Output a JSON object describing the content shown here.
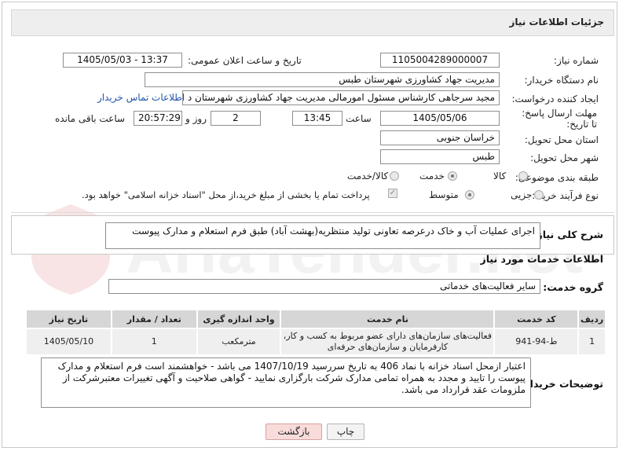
{
  "header": {
    "title": "جزئیات اطلاعات نیاز"
  },
  "form": {
    "need_number_label": "شماره نیاز:",
    "need_number": "1105004289000007",
    "announce_label": "تاریخ و ساعت اعلان عمومی:",
    "announce_value": "1405/05/03 - 13:37",
    "buyer_org_label": "نام دستگاه خریدار:",
    "buyer_org": "مدیریت جهاد کشاورزی شهرستان طبس",
    "creator_label": "ایجاد کننده درخواست:",
    "creator": "مجید سرجاهی کارشناس مسئول امورمالی مدیریت جهاد کشاورزی شهرستان د",
    "contact_link": "اطلاعات تماس خریدار",
    "deadline_label": "مهلت ارسال پاسخ: تا تاریخ:",
    "deadline_date": "1405/05/06",
    "time_label": "ساعت",
    "deadline_time": "13:45",
    "days_value": "2",
    "days_label": "روز و",
    "remaining_time": "20:57:29",
    "remaining_label": "ساعت باقی مانده",
    "province_label": "استان محل تحویل:",
    "province": "خراسان جنوبی",
    "city_label": "شهر محل تحویل:",
    "city": "طبس",
    "category_label": "طبقه بندی موضوعی:",
    "category_options": [
      "کالا",
      "خدمت",
      "کالا/خدمت"
    ],
    "category_selected": "خدمت",
    "process_label": "نوع فرآیند خرید :",
    "process_options": [
      "جزیی",
      "متوسط"
    ],
    "process_selected": "متوسط",
    "payment_note": "پرداخت تمام یا بخشی از مبلغ خرید،از محل \"اسناد خزانه اسلامی\" خواهد بود."
  },
  "summary": {
    "label": "شرح کلی نیاز:",
    "text": "اجرای عملیات آب و خاک درعرصه تعاونی تولید منتظریه(بهشت آباد) طبق فرم استعلام و مدارک پیوست"
  },
  "services": {
    "section_title": "اطلاعات خدمات مورد نیاز",
    "group_label": "گروه خدمت:",
    "group_value": "سایر فعالیت‌های خدماتی",
    "columns": [
      "ردیف",
      "کد خدمت",
      "نام خدمت",
      "واحد اندازه گیری",
      "تعداد / مقدار",
      "تاریخ نیاز"
    ],
    "rows": [
      {
        "row": "1",
        "code": "ط-94-941",
        "name_line1": "فعالیت‌های سازمان‌های دارای عضو مربوط به کسب و کار،",
        "name_line2": "کارفرمایان و سازمان‌های حرفه‌ای",
        "unit": "مترمکعب",
        "qty": "1",
        "date": "1405/05/10"
      }
    ]
  },
  "notes": {
    "label": "توضیحات خریدار:",
    "text": "اعتبار ازمحل اسناد خزانه با نماد 406 به تاریخ سررسید 1407/10/19 می باشد - خواهشمند است فرم استعلام و مدارک پیوست را تایید و مجدد به همراه تمامی مدارک شرکت بارگزاری نمایید - گواهی صلاحیت و آگهی تغییرات معتبرشرکت از ملزومات عقد قرارداد می باشد."
  },
  "buttons": {
    "print": "چاپ",
    "back": "بازگشت"
  },
  "watermark": "AriaTender.net",
  "colors": {
    "header_bg": "#eeeeee",
    "link": "#2255aa",
    "back_button_bg": "#f8dcdc",
    "table_header": "#d6d6d6"
  }
}
